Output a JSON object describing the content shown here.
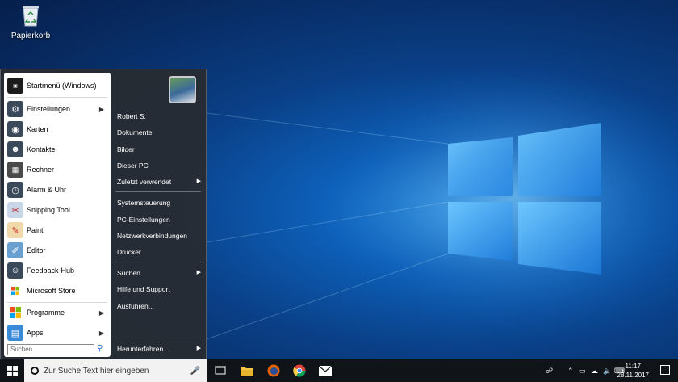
{
  "desktop": {
    "icon_label": "Papierkorb"
  },
  "start_menu": {
    "apps": [
      {
        "label": "Startmenü (Windows)",
        "icon": "start-logo-icon",
        "color": "#1c1c1c",
        "arrow": false
      },
      {
        "label": "Einstellungen",
        "icon": "gear-icon",
        "color": "#3b4a5a",
        "arrow": true
      },
      {
        "label": "Karten",
        "icon": "maps-icon",
        "color": "#3b4a5a",
        "arrow": false
      },
      {
        "label": "Kontakte",
        "icon": "people-icon",
        "color": "#3b4a5a",
        "arrow": false
      },
      {
        "label": "Rechner",
        "icon": "calculator-icon",
        "color": "#4a4a4a",
        "arrow": false
      },
      {
        "label": "Alarm & Uhr",
        "icon": "clock-icon",
        "color": "#3b4a5a",
        "arrow": false
      },
      {
        "label": "Snipping Tool",
        "icon": "scissors-icon",
        "color": "#c8d8e8",
        "arrow": false
      },
      {
        "label": "Paint",
        "icon": "paint-icon",
        "color": "#e8d0a0",
        "arrow": false
      },
      {
        "label": "Editor",
        "icon": "notepad-icon",
        "color": "#6aa0d0",
        "arrow": false
      },
      {
        "label": "Feedback-Hub",
        "icon": "feedback-icon",
        "color": "#3b4a5a",
        "arrow": false
      },
      {
        "label": "Microsoft Store",
        "icon": "store-icon",
        "color": "#ffffff",
        "arrow": false
      }
    ],
    "bottom_apps": [
      {
        "label": "Programme",
        "icon": "windows-flag-icon",
        "arrow": true
      },
      {
        "label": "Apps",
        "icon": "apps-icon",
        "arrow": true
      }
    ],
    "search_placeholder": "Suchen",
    "right_items": {
      "user": "Robert S.",
      "documents": "Dokumente",
      "pictures": "Bilder",
      "this_pc": "Dieser PC",
      "recent": "Zuletzt verwendet",
      "control_panel": "Systemsteuerung",
      "pc_settings": "PC-Einstellungen",
      "network": "Netzwerkverbindungen",
      "printers": "Drucker",
      "search": "Suchen",
      "help": "Hilfe und Support",
      "run": "Ausführen...",
      "shutdown": "Herunterfahren..."
    }
  },
  "taskbar": {
    "search_text": "Zur Suche Text hier eingeben",
    "time": "11:17",
    "date": "28.11.2017"
  }
}
